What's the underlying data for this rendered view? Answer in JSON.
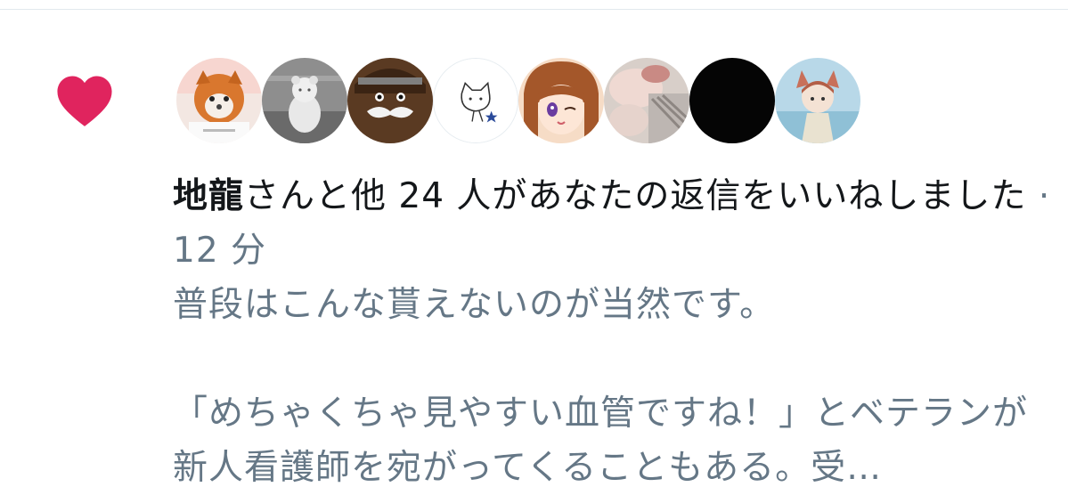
{
  "notification": {
    "type_icon": "heart-icon",
    "accent_color": "#e0245e",
    "avatars": [
      {
        "name": "avatar-1",
        "depicts": "shiba dog costume figure"
      },
      {
        "name": "avatar-2",
        "depicts": "white bear figurine"
      },
      {
        "name": "avatar-3",
        "depicts": "cartoon mustache character"
      },
      {
        "name": "avatar-4",
        "depicts": "sketch cat with star"
      },
      {
        "name": "avatar-5",
        "depicts": "anime girl winking"
      },
      {
        "name": "avatar-6",
        "depicts": "blurred photo"
      },
      {
        "name": "avatar-7",
        "depicts": "black circle"
      },
      {
        "name": "avatar-8",
        "depicts": "illustrated girl with blue tones"
      }
    ],
    "actor_name": "地龍",
    "summary_text": "さんと他 24 人があなたの返信をいいねしました",
    "separator": " · ",
    "timestamp": "12 分",
    "tweet_text": "普段はこんな貰えないのが当然です。\n\n「めちゃくちゃ見やすい血管ですね！」とベテランが新人看護師を宛がってくることもある。受…"
  }
}
